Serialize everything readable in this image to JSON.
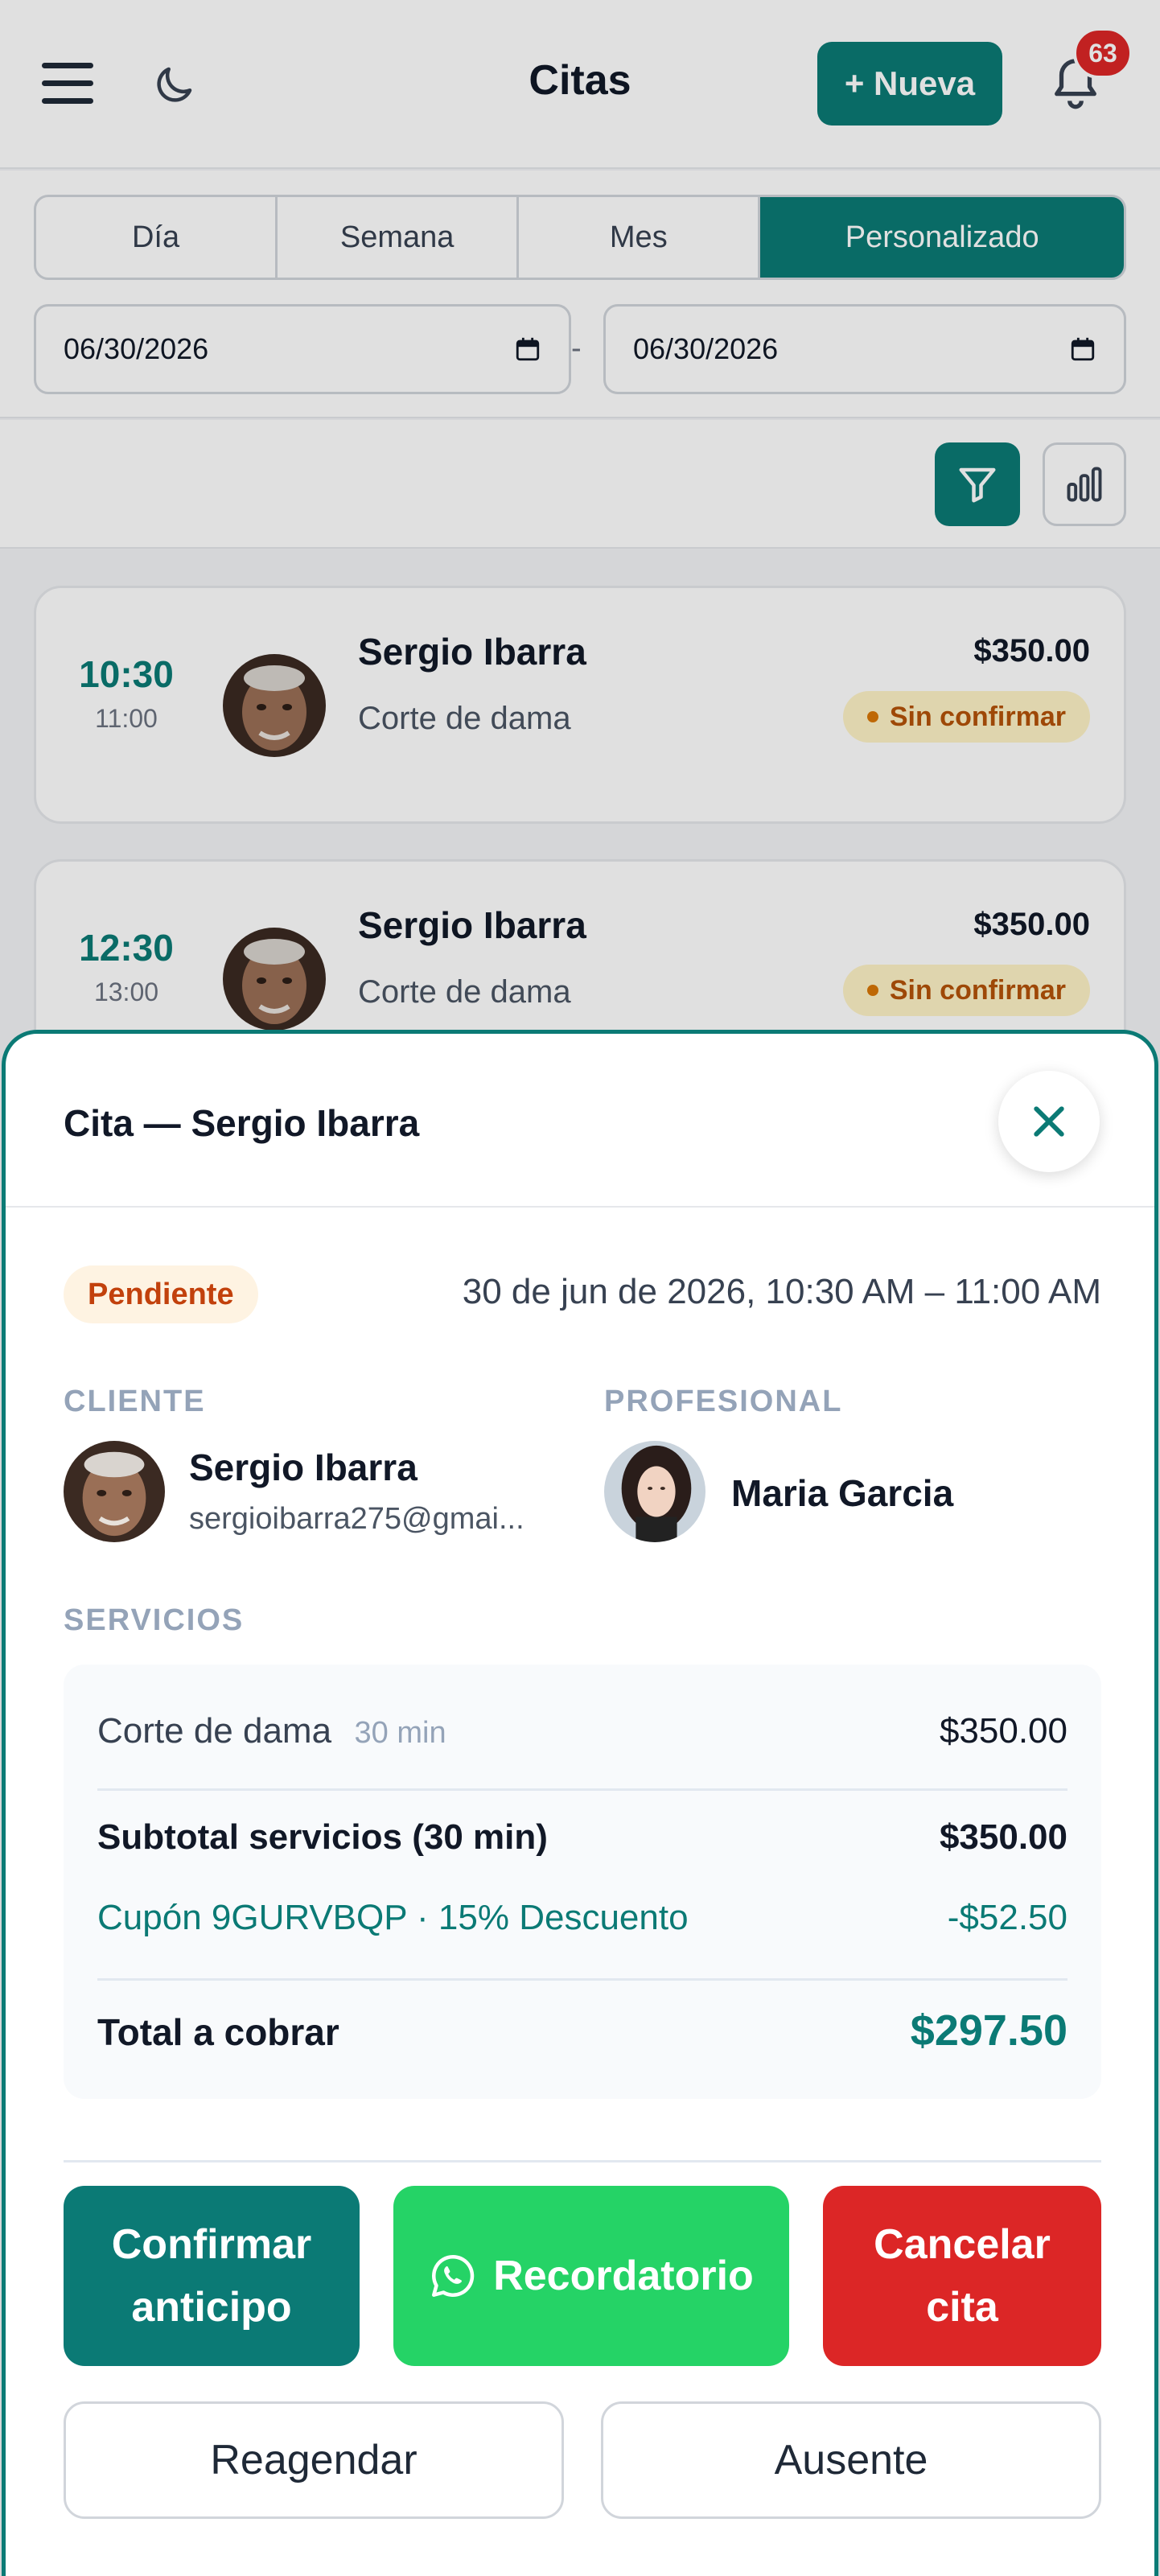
{
  "header": {
    "title": "Citas",
    "new_button": "+ Nueva",
    "notifications_count": "63"
  },
  "tabs": [
    {
      "label": "Día",
      "active": false
    },
    {
      "label": "Semana",
      "active": false
    },
    {
      "label": "Mes",
      "active": false
    },
    {
      "label": "Personalizado",
      "active": true
    }
  ],
  "date_range": {
    "start": "06/30/2026",
    "separator": "-",
    "end": "06/30/2026"
  },
  "appointments": [
    {
      "start": "10:30",
      "end": "11:00",
      "client": "Sergio Ibarra",
      "service": "Corte de dama",
      "price": "$350.00",
      "status": "Sin confirmar"
    },
    {
      "start": "12:30",
      "end": "13:00",
      "client": "Sergio Ibarra",
      "service": "Corte de dama",
      "price": "$350.00",
      "status": "Sin confirmar"
    }
  ],
  "detail": {
    "title": "Cita — Sergio Ibarra",
    "status": "Pendiente",
    "datetime": "30 de jun de 2026, 10:30 AM – 11:00 AM",
    "client_label": "CLIENTE",
    "client_name": "Sergio Ibarra",
    "client_email": "sergioibarra275@gmai...",
    "professional_label": "PROFESIONAL",
    "professional_name": "Maria Garcia",
    "services_label": "SERVICIOS",
    "service": {
      "name": "Corte de dama",
      "duration": "30 min",
      "price": "$350.00"
    },
    "subtotal_label": "Subtotal servicios (30 min)",
    "subtotal_value": "$350.00",
    "coupon_label": "Cupón 9GURVBQP · 15% Descuento",
    "coupon_value": "-$52.50",
    "total_label": "Total a cobrar",
    "total_value": "$297.50"
  },
  "actions": {
    "confirm_line1": "Confirmar",
    "confirm_line2": "anticipo",
    "reminder": "Recordatorio",
    "cancel_line1": "Cancelar",
    "cancel_line2": "cita",
    "reschedule": "Reagendar",
    "absent": "Ausente"
  },
  "colors": {
    "accent": "#0b7a75",
    "whatsapp": "#25d366",
    "danger": "#dc2626",
    "pending": "#c2410c"
  }
}
